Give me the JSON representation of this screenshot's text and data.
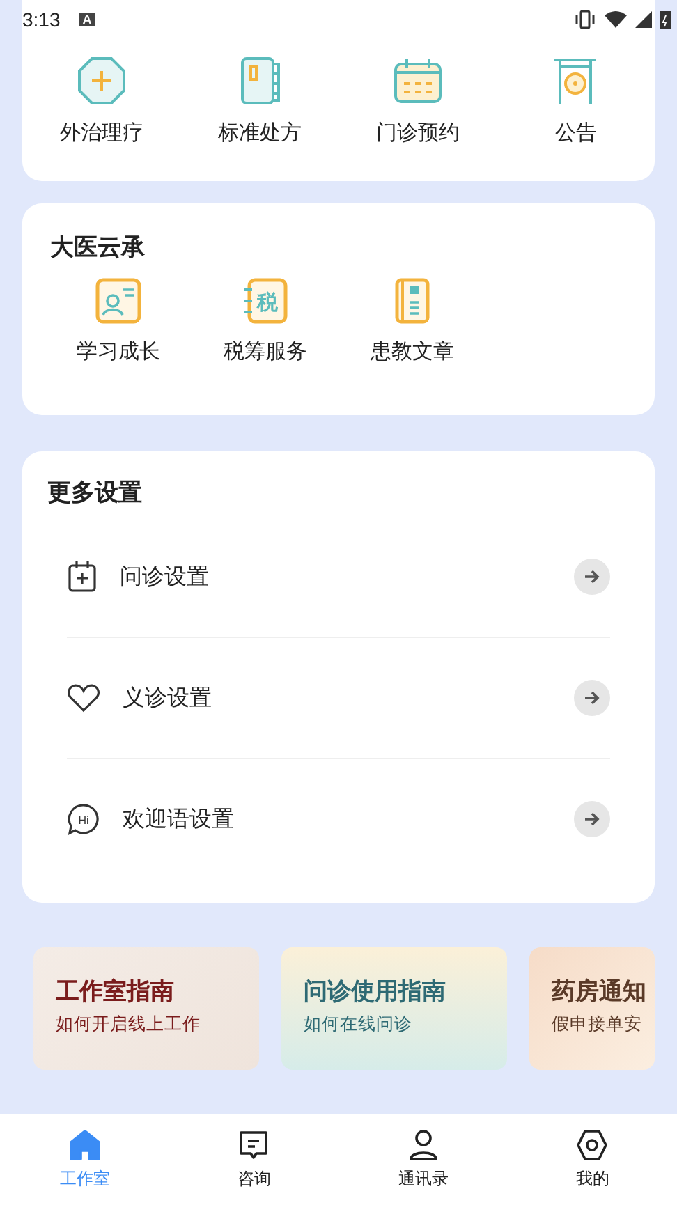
{
  "status_bar": {
    "time": "3:13",
    "badge": "A"
  },
  "services": [
    {
      "label": "外治理疗",
      "kind": "octagon"
    },
    {
      "label": "标准处方",
      "kind": "book"
    },
    {
      "label": "门诊预约",
      "kind": "calendar"
    },
    {
      "label": "公告",
      "kind": "gong"
    }
  ],
  "heritage": {
    "title": "大医云承",
    "items": [
      {
        "label": "学习成长",
        "kind": "profile"
      },
      {
        "label": "税筹服务",
        "kind": "tax",
        "glyph": "税"
      },
      {
        "label": "患教文章",
        "kind": "article"
      }
    ]
  },
  "settings": {
    "title": "更多设置",
    "items": [
      {
        "label": "问诊设置",
        "kind": "calendar-plus"
      },
      {
        "label": "义诊设置",
        "kind": "heart"
      },
      {
        "label": "欢迎语设置",
        "kind": "chat",
        "glyph": "Hi"
      }
    ]
  },
  "banners": [
    {
      "title": "工作室指南",
      "subtitle": "如何开启线上工作",
      "kind": "studio"
    },
    {
      "title": "问诊使用指南",
      "subtitle": "如何在线问诊",
      "kind": "consult"
    },
    {
      "title": "药房通知",
      "subtitle": "假申接单安",
      "kind": "pharmacy"
    }
  ],
  "tabs": [
    {
      "label": "工作室",
      "kind": "home",
      "selected": true
    },
    {
      "label": "咨询",
      "kind": "chat",
      "selected": false
    },
    {
      "label": "通讯录",
      "kind": "person",
      "selected": false
    },
    {
      "label": "我的",
      "kind": "hex",
      "selected": false
    }
  ]
}
